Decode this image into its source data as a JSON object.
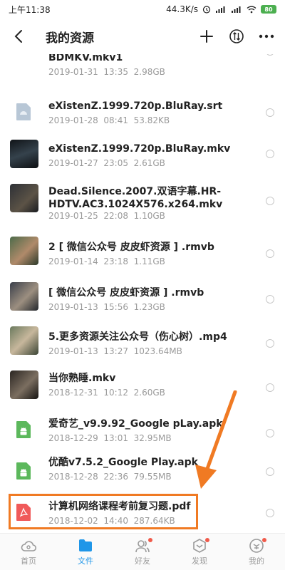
{
  "status_bar": {
    "time": "上午11:38",
    "network_speed": "44.3K/s",
    "battery": "80"
  },
  "header": {
    "title": "我的资源",
    "icons": [
      "back-arrow-icon",
      "plus-icon",
      "sort-icon",
      "more-icon"
    ]
  },
  "files": [
    {
      "name": "BDMKV.mkv1",
      "date": "2019-01-31",
      "time": "13:35",
      "size": "2.98GB",
      "icon": "video-thumbnail"
    },
    {
      "name": "eXistenZ.1999.720p.BluRay.srt",
      "date": "2019-01-28",
      "time": "08:41",
      "size": "53.82KB",
      "icon": "subtitle-file-icon"
    },
    {
      "name": "eXistenZ.1999.720p.BluRay.mkv",
      "date": "2019-01-27",
      "time": "23:05",
      "size": "2.61GB",
      "icon": "video-thumbnail"
    },
    {
      "name": "Dead.Silence.2007.双语字幕.HR-HDTV.AC3.1024X576.x264.mkv",
      "date": "2019-01-25",
      "time": "22:08",
      "size": "1.10GB",
      "icon": "video-thumbnail"
    },
    {
      "name": "2 [ 微信公众号 皮皮虾资源 ] .rmvb",
      "date": "2019-01-14",
      "time": "23:18",
      "size": "1.11GB",
      "icon": "video-thumbnail"
    },
    {
      "name": "[ 微信公众号 皮皮虾资源 ] .rmvb",
      "date": "2019-01-13",
      "time": "15:56",
      "size": "1.23GB",
      "icon": "video-thumbnail"
    },
    {
      "name": "5.更多资源关注公众号（伤心树）.mp4",
      "date": "2019-01-13",
      "time": "13:27",
      "size": "1023.64MB",
      "icon": "video-thumbnail"
    },
    {
      "name": "当你熟睡.mkv",
      "date": "2018-12-31",
      "time": "10:12",
      "size": "2.60GB",
      "icon": "video-thumbnail"
    },
    {
      "name": "爱奇艺_v9.9.92_Google pLay.apk",
      "date": "2018-12-29",
      "time": "13:01",
      "size": "32.95MB",
      "icon": "android-apk-icon"
    },
    {
      "name": "优酷v7.5.2_Google Play.apk",
      "date": "2018-12-28",
      "time": "22:36",
      "size": "79.55MB",
      "icon": "android-apk-icon"
    },
    {
      "name": "计算机网络课程考前复习题.pdf",
      "date": "2018-12-02",
      "time": "14:40",
      "size": "287.64KB",
      "icon": "pdf-file-icon"
    }
  ],
  "tabs": [
    {
      "label": "首页",
      "icon": "cloud-icon",
      "active": false,
      "badge": false
    },
    {
      "label": "文件",
      "icon": "folder-icon",
      "active": true,
      "badge": false
    },
    {
      "label": "好友",
      "icon": "friends-icon",
      "active": false,
      "badge": true
    },
    {
      "label": "发现",
      "icon": "discover-icon",
      "active": false,
      "badge": true
    },
    {
      "label": "我的",
      "icon": "profile-icon",
      "active": false,
      "badge": true
    }
  ],
  "colors": {
    "accent": "#1f96e8",
    "highlight": "#f07a23",
    "apk_green": "#5cb85c",
    "pdf_red": "#f05a5a",
    "badge_red": "#f05a4a"
  }
}
